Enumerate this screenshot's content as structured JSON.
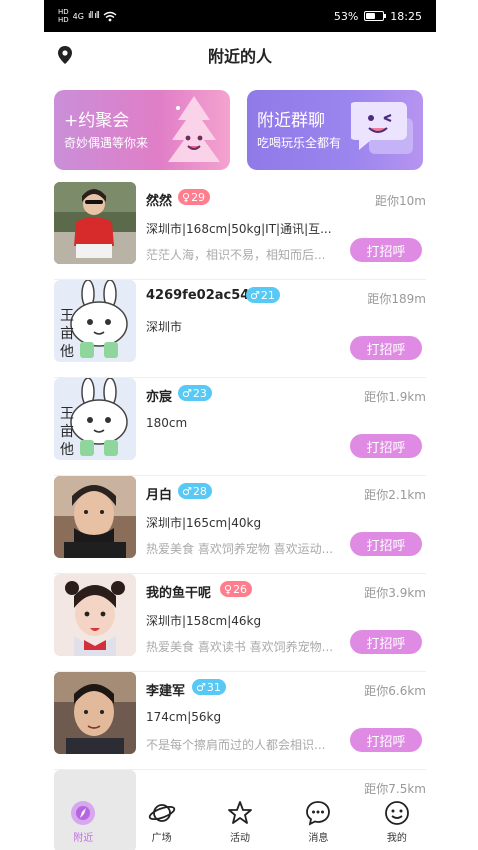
{
  "status_bar": {
    "hd1": "HD",
    "hd2": "HD",
    "net": "4G",
    "signal": "ıll ıll",
    "battery": "53%",
    "battery_level": 0.53,
    "time": "18:25"
  },
  "header": {
    "title": "附近的人"
  },
  "banners": [
    {
      "title": "+约聚会",
      "subtitle": "奇妙偶遇等你来"
    },
    {
      "title": "附近群聊",
      "subtitle": "吃喝玩乐全都有"
    }
  ],
  "greet_label": "打招呼",
  "users": [
    {
      "name": "然然",
      "gender": "female",
      "age": "29",
      "distance": "距你10m",
      "info": "深圳市|168cm|50kg|IT|通讯|互...",
      "bio": "茫茫人海，相识不易，相知而后..."
    },
    {
      "name": "4269fe02ac54",
      "gender": "male",
      "age": "21",
      "distance": "距你189m",
      "info": "深圳市",
      "bio": ""
    },
    {
      "name": "亦宸",
      "gender": "male",
      "age": "23",
      "distance": "距你1.9km",
      "info": "180cm",
      "bio": ""
    },
    {
      "name": "月白",
      "gender": "male",
      "age": "28",
      "distance": "距你2.1km",
      "info": "深圳市|165cm|40kg",
      "bio": "热爱美食 喜欢饲养宠物 喜欢运动..."
    },
    {
      "name": "我的鱼干呢",
      "gender": "female",
      "age": "26",
      "distance": "距你3.9km",
      "info": "深圳市|158cm|46kg",
      "bio": "热爱美食 喜欢读书 喜欢饲养宠物..."
    },
    {
      "name": "李建军",
      "gender": "male",
      "age": "31",
      "distance": "距你6.6km",
      "info": "174cm|56kg",
      "bio": "不是每个擦肩而过的人都会相识..."
    },
    {
      "name": "",
      "gender": "",
      "age": "",
      "distance": "距你7.5km",
      "info": "",
      "bio": ""
    }
  ],
  "tabs": [
    {
      "label": "附近",
      "icon": "compass-icon"
    },
    {
      "label": "广场",
      "icon": "planet-icon"
    },
    {
      "label": "活动",
      "icon": "star-icon"
    },
    {
      "label": "消息",
      "icon": "chat-bubble-icon"
    },
    {
      "label": "我的",
      "icon": "smiley-icon"
    }
  ],
  "colors": {
    "accent": "#df8be4",
    "female_badge": "#ff7d8c",
    "male_badge": "#58c9f4",
    "active_tab": "#c070e0"
  }
}
